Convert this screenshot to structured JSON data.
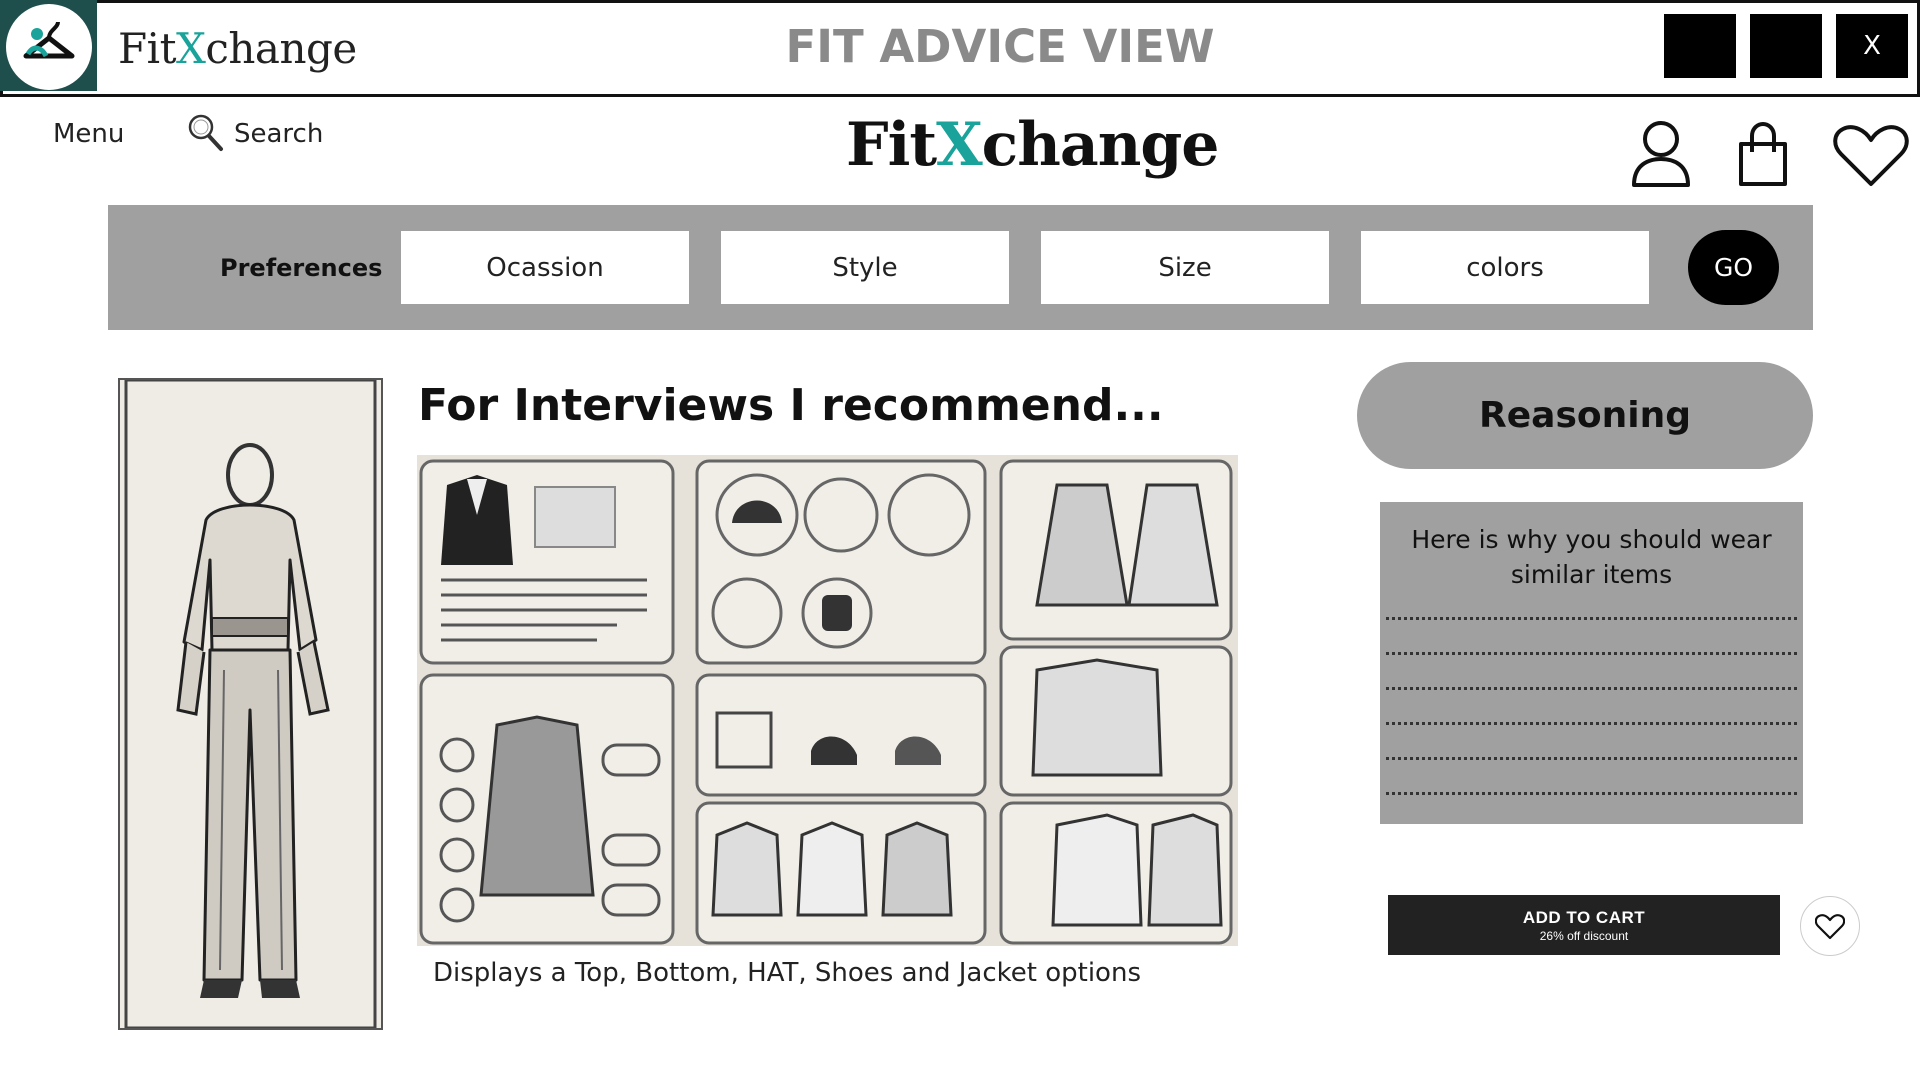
{
  "window": {
    "title": "FIT ADVICE VIEW",
    "brand_prefix": "Fit",
    "brand_x": "X",
    "brand_suffix": "change",
    "controls": [
      "",
      "",
      "X"
    ]
  },
  "header": {
    "menu_label": "Menu",
    "search_label": "Search",
    "brand_prefix": "Fit",
    "brand_x": "X",
    "brand_suffix": "change",
    "icons": [
      "user-icon",
      "shopping-bag-icon",
      "heart-icon"
    ]
  },
  "preferences": {
    "label": "Preferences",
    "fields": [
      "Ocassion",
      "Style",
      "Size",
      "colors"
    ],
    "go_label": "GO"
  },
  "main": {
    "heading": "For Interviews I recommend...",
    "caption": "Displays a Top, Bottom, HAT, Shoes and Jacket options"
  },
  "reasoning": {
    "title": "Reasoning",
    "text": "Here is why you should wear similar items"
  },
  "cart": {
    "button_label": "ADD TO CART",
    "discount_text": "26% off discount"
  },
  "colors": {
    "accent": "#1aa39a",
    "panel_gray": "#a0a0a0",
    "logo_bg": "#1f4f4d"
  }
}
